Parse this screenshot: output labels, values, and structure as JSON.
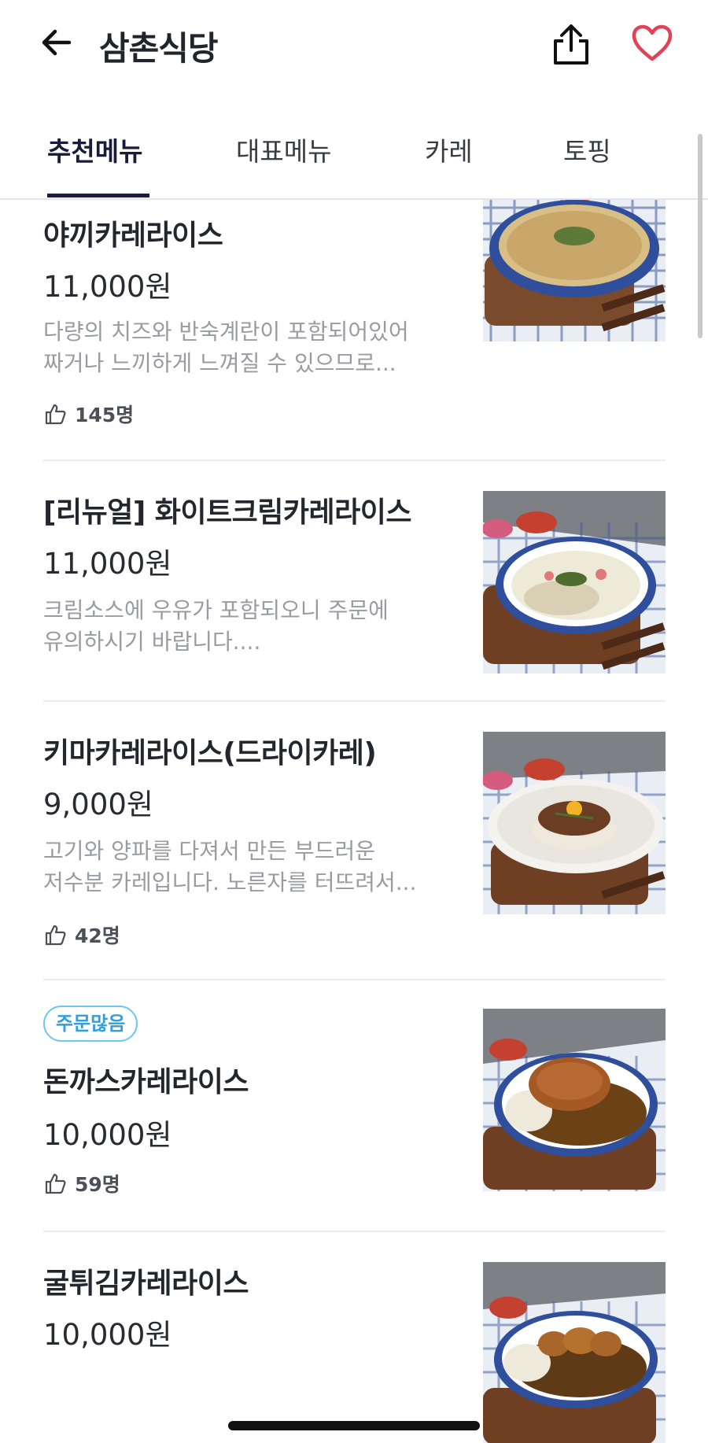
{
  "header": {
    "title": "삼촌식당",
    "icons": {
      "back": "arrow-left-icon",
      "share": "share-icon",
      "favorite": "heart-icon"
    },
    "heart_color": "#e04356"
  },
  "tabs": [
    {
      "label": "추천메뉴",
      "active": true
    },
    {
      "label": "대표메뉴",
      "active": false
    },
    {
      "label": "카레",
      "active": false
    },
    {
      "label": "토핑",
      "active": false
    }
  ],
  "items": [
    {
      "name": "야끼카레라이스",
      "price": "11,000원",
      "desc1": "다량의 치즈와 반숙계란이 포함되어있어",
      "desc2": "짜거나 느끼하게 느껴질 수 있으므로...",
      "likes": "145명"
    },
    {
      "name": "[리뉴얼] 화이트크림카레라이스",
      "price": "11,000원",
      "desc1": "크림소스에 우유가 포함되오니 주문에",
      "desc2": "유의하시기 바랍니다...."
    },
    {
      "name": "키마카레라이스(드라이카레)",
      "price": "9,000원",
      "desc1": "고기와 양파를 다져서 만든 부드러운",
      "desc2": "저수분 카레입니다. 노른자를 터뜨려서...",
      "likes": "42명"
    },
    {
      "badge": "주문많음",
      "name": "돈까스카레라이스",
      "price": "10,000원",
      "likes": "59명"
    },
    {
      "name": "굴튀김카레라이스",
      "price": "10,000원"
    }
  ],
  "colors": {
    "accent": "#1c1c3c",
    "badge": "#2f9fe0",
    "muted_text": "#9a9aa3"
  }
}
